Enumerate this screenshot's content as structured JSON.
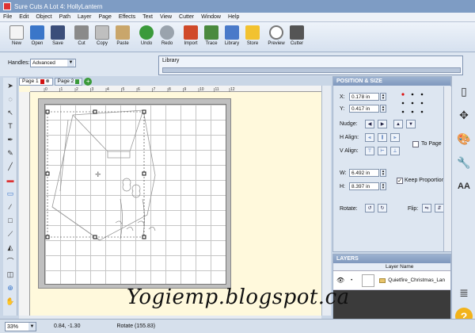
{
  "window": {
    "title": "Sure Cuts A Lot 4: HollyLantern"
  },
  "menu": [
    "File",
    "Edit",
    "Object",
    "Path",
    "Layer",
    "Page",
    "Effects",
    "Text",
    "View",
    "Cutter",
    "Window",
    "Help"
  ],
  "toolbar": [
    {
      "label": "New",
      "icon": "new-document-icon",
      "color": "#f4f4f4"
    },
    {
      "label": "Open",
      "icon": "open-folder-icon",
      "color": "#3a76c9"
    },
    {
      "label": "Save",
      "icon": "save-disk-icon",
      "color": "#3b4e7a"
    },
    {
      "label": "Cut",
      "icon": "scissors-icon",
      "color": "#8a8a8a"
    },
    {
      "label": "Copy",
      "icon": "copy-icon",
      "color": "#bfbfbf"
    },
    {
      "label": "Paste",
      "icon": "paste-icon",
      "color": "#c9a66b"
    },
    {
      "label": "Undo",
      "icon": "undo-arrow-icon",
      "color": "#3b9a3b"
    },
    {
      "label": "Redo",
      "icon": "redo-arrow-icon",
      "color": "#9aa3ad"
    },
    {
      "label": "Import",
      "icon": "import-svg-icon",
      "color": "#d04a2a"
    },
    {
      "label": "Trace",
      "icon": "trace-icon",
      "color": "#4a8a3e"
    },
    {
      "label": "Library",
      "icon": "library-icon",
      "color": "#4a7ac9"
    },
    {
      "label": "Store",
      "icon": "store-icon",
      "color": "#f2c230"
    },
    {
      "label": "Preview",
      "icon": "preview-magnifier-icon",
      "color": "#777777"
    },
    {
      "label": "Cutter",
      "icon": "cutter-icon",
      "color": "#555555"
    }
  ],
  "handles": {
    "label": "Handles:",
    "value": "Advanced"
  },
  "library": {
    "title": "Library"
  },
  "tabs": [
    {
      "label": "Page 1",
      "color": "#d11111"
    },
    {
      "label": "Page 2",
      "color": "#3a9a3a"
    }
  ],
  "ruler": {
    "ticks": [
      "0",
      "1",
      "2",
      "3",
      "4",
      "5",
      "6",
      "7",
      "8",
      "9",
      "10",
      "11",
      "12"
    ]
  },
  "position_size": {
    "title": "POSITION & SIZE",
    "x_label": "X:",
    "x_value": "0.178 in",
    "y_label": "Y:",
    "y_value": "0.417 in",
    "nudge_label": "Nudge:",
    "halign_label": "H Align:",
    "valign_label": "V Align:",
    "to_page_label": "To Page",
    "w_label": "W:",
    "w_value": "6.492 in",
    "h_label": "H:",
    "h_value": "8.397 in",
    "keep_proportions_label": "Keep Proportions",
    "keep_proportions_checked": true,
    "rotate_label": "Rotate:",
    "flip_label": "Flip:"
  },
  "layers": {
    "title": "LAYERS",
    "column": "Layer Name",
    "rows": [
      {
        "name": "Quietfire_Christmas_Lan"
      }
    ]
  },
  "status": {
    "zoom": "33%",
    "coords": "0.84, -1.30",
    "rotate": "Rotate (155.83)"
  },
  "watermark": "Yogiemp.blogspot.ca",
  "colors": {
    "titlebar": "#7e9cc4",
    "panel_header": "#7f98bd",
    "canvas_bg": "#fff9dc"
  }
}
